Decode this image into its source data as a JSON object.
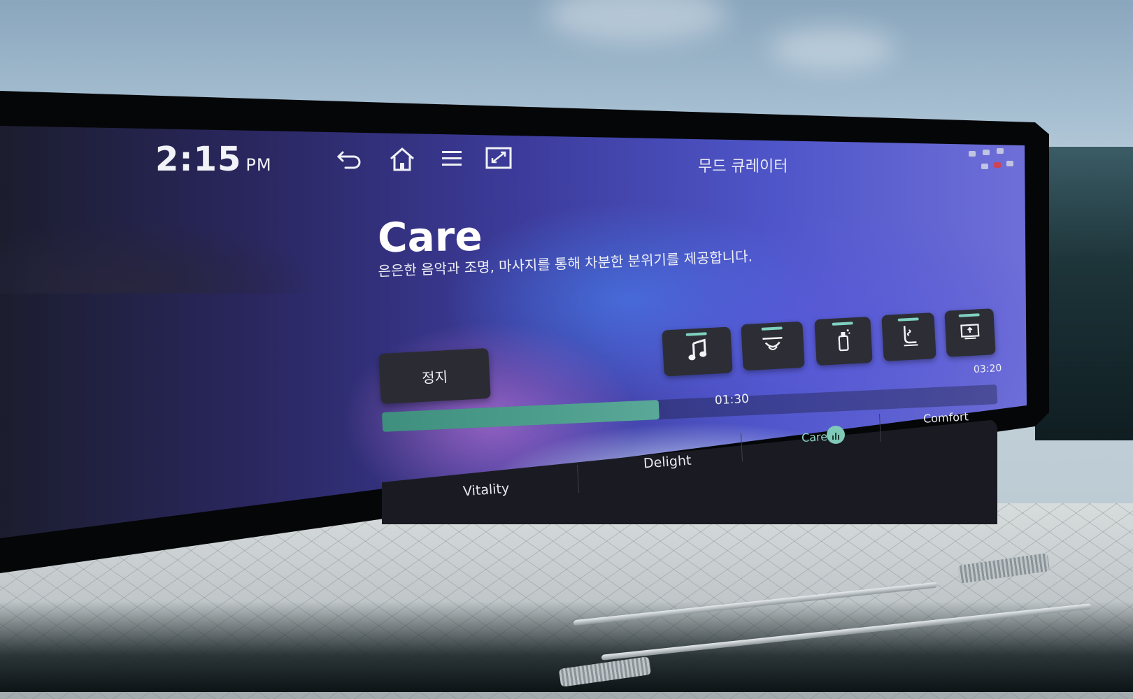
{
  "status_bar": {
    "time": "2:15",
    "ampm": "PM",
    "icons": [
      "back-icon",
      "home-icon",
      "menu-icon",
      "fullscreen-icon"
    ],
    "screen_title": "무드 큐레이터"
  },
  "mode": {
    "title": "Care",
    "description": "은은한 음악과 조명, 마사지를 통해 차분한 분위기를 제공합니다."
  },
  "controls": {
    "stop_label": "정지",
    "features": [
      {
        "icon": "music-note-icon"
      },
      {
        "icon": "ambient-light-icon"
      },
      {
        "icon": "fragrance-icon"
      },
      {
        "icon": "seat-massage-icon"
      },
      {
        "icon": "display-panel-icon"
      }
    ]
  },
  "playback": {
    "elapsed": "01:30",
    "total": "03:20",
    "progress_fraction": 0.45
  },
  "tabs": [
    {
      "label": "Vitality",
      "active": false
    },
    {
      "label": "Delight",
      "active": false
    },
    {
      "label": "Care",
      "active": true
    },
    {
      "label": "Comfort",
      "active": false
    }
  ],
  "colors": {
    "accent": "#7fd1c0",
    "progress": "#4e9e8d",
    "button_bg": "#2d2e35",
    "tabbar_bg": "#1a1b22"
  }
}
